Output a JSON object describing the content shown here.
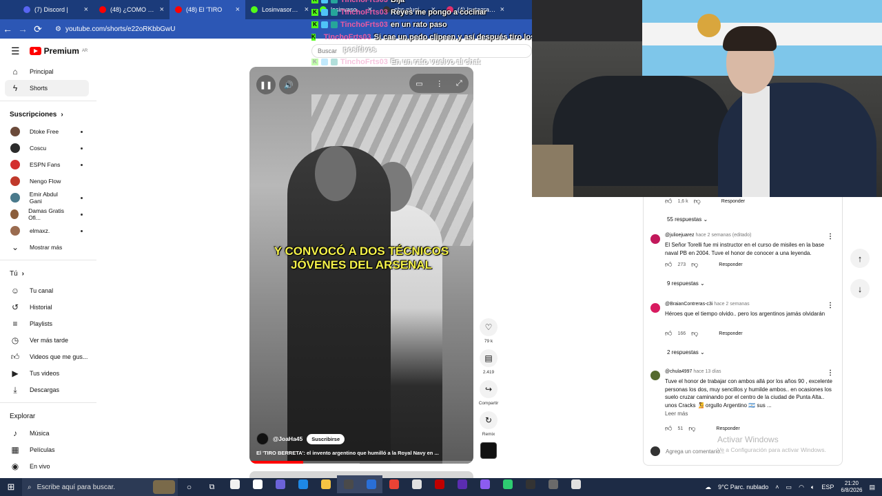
{
  "browser": {
    "tabs": [
      {
        "label": "(7) Discord |",
        "color": "#5865f2",
        "active": false
      },
      {
        "label": "(48) ¿COMO HAC",
        "color": "#ff0000",
        "active": false
      },
      {
        "label": "(48) El 'TIRO",
        "color": "#ff0000",
        "active": true
      },
      {
        "label": "Losinvasores Stre",
        "color": "#53fc18",
        "active": false
      },
      {
        "label": "losinvasores Stre",
        "color": "#53fc18",
        "active": false
      },
      {
        "label": "obs-plugin-stre",
        "color": "#333333",
        "active": false
      },
      {
        "label": "(4) Instagram • M",
        "color": "#e1306c",
        "active": false
      }
    ],
    "url": "youtube.com/shorts/e22oRKbbGwU"
  },
  "youtube": {
    "brand": "Premium",
    "region": "AR",
    "search_placeholder": "Buscar",
    "nav": [
      {
        "label": "Principal",
        "icon": "home-icon"
      },
      {
        "label": "Shorts",
        "icon": "shorts-icon",
        "active": true
      }
    ],
    "subscriptions_title": "Suscripciones",
    "subscriptions": [
      {
        "label": "Dtoke Free",
        "color": "#6b4a3a",
        "dot": true
      },
      {
        "label": "Coscu",
        "color": "#2b2b2b",
        "dot": true
      },
      {
        "label": "ESPN Fans",
        "color": "#d32f2f",
        "dot": true
      },
      {
        "label": "Nengo Flow",
        "color": "#c0392b",
        "dot": false
      },
      {
        "label": "Emir Abdul Gani",
        "color": "#4a7a8c",
        "dot": true
      },
      {
        "label": "Damas Gratis Ofi...",
        "color": "#8b5e3c",
        "dot": true
      },
      {
        "label": "elmaxz.",
        "color": "#9a6b4f",
        "dot": true
      }
    ],
    "show_more": "Mostrar más",
    "you_title": "Tú",
    "you_items": [
      {
        "label": "Tu canal",
        "icon": "user-icon"
      },
      {
        "label": "Historial",
        "icon": "history-icon"
      },
      {
        "label": "Playlists",
        "icon": "playlist-icon"
      },
      {
        "label": "Ver más tarde",
        "icon": "clock-icon"
      },
      {
        "label": "Videos que me gus...",
        "icon": "like-icon"
      },
      {
        "label": "Tus videos",
        "icon": "video-icon"
      },
      {
        "label": "Descargas",
        "icon": "download-icon"
      }
    ],
    "explore_title": "Explorar",
    "explore_items": [
      {
        "label": "Música",
        "icon": "music-icon"
      },
      {
        "label": "Películas",
        "icon": "film-icon"
      },
      {
        "label": "En vivo",
        "icon": "live-icon"
      }
    ]
  },
  "video": {
    "caption": "Y CONVOCÓ A DOS TÉCNICOS JÓVENES DEL ARSENAL",
    "channel": "@JoaHa45",
    "subscribe": "Suscribirse",
    "title": "El 'TIRO BERRETA': el invento argentino que humilló a la Royal Navy en ...",
    "progress": 0.24,
    "likes": "79 k",
    "comments": "2.419",
    "share": "Compartir",
    "remix": "Remix"
  },
  "chat": [
    {
      "user": "TinchoFrts03",
      "msg": "Bija",
      "faded": false
    },
    {
      "user": "TinchoFrts03",
      "msg": "Reyes me pongo a cocinar",
      "faded": false
    },
    {
      "user": "TinchoFrts03",
      "msg": "en un rato paso",
      "faded": false
    },
    {
      "user": "TinchoFrts03",
      "msg": "Si cae un pedo clipeen y así después tiro los 14",
      "faded": false
    },
    {
      "user": "",
      "msg": "positivos",
      "faded": true
    },
    {
      "user": "TinchoFrts03",
      "msg": "En un rato vuelvo al chat",
      "faded": true
    }
  ],
  "comments": {
    "top_likes": "1,6 k",
    "top_reply": "Responder",
    "top_replies": "55 respuestas",
    "items": [
      {
        "user": "@julioejuarez",
        "meta": "hace 2 semanas (editado)",
        "text": "El Señor Torelli fue mi instructor en el curso de misiles en la base naval PB en 2004. Tuve el honor de conocer a una leyenda.",
        "likes": "273",
        "reply": "Responder",
        "replies": "9 respuestas",
        "color": "#c2185b"
      },
      {
        "user": "@BraianContreras-c3i",
        "meta": "hace 2 semanas",
        "text": "Héroes que el tiempo olvido.. pero los argentinos jamás olvidarán",
        "likes": "166",
        "reply": "Responder",
        "replies": "2 respuestas",
        "color": "#d81b60"
      },
      {
        "user": "@chula4997",
        "meta": "hace 13 días",
        "text": "Tuve el honor de trabajar con ambos allá por los años 90 , excelente personas los dos, muy sencillos y humilde ambos.. en ocasiones los suelo cruzar caminando por el centro de la ciudad de Punta Alta.. unos Cracks 🧏 orgullo Argentino 🇦🇷 sus ...",
        "read_more": "Leer más",
        "likes": "51",
        "reply": "Responder",
        "color": "#556b2f"
      }
    ],
    "add_placeholder": "Agrega un comentario..."
  },
  "watermark": {
    "line1": "Activar Windows",
    "line2": "Ve a Configuración para activar Windows."
  },
  "taskbar": {
    "search_placeholder": "Escribe aquí para buscar.",
    "weather": "9°C  Parc. nublado",
    "lang": "ESP",
    "time": "21:20",
    "date": "6/8/2026",
    "apps": [
      "#f0f0f0",
      "#ffffff",
      "#6b63d9",
      "#1e88e5",
      "#f6c343",
      "#4a4a4a",
      "#2a6fd6",
      "#ea4335",
      "#e0e0e0",
      "#c00000",
      "#5b2db1",
      "#8c5cf0",
      "#2ecc71",
      "#333333",
      "#6a6a6a",
      "#e0e0e0"
    ]
  }
}
